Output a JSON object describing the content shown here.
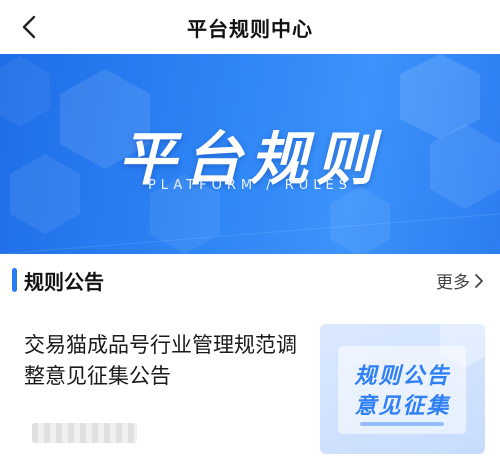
{
  "nav": {
    "title": "平台规则中心",
    "back_icon": "chevron-left-icon"
  },
  "banner": {
    "title": "平台规则",
    "subtitle": "PLATFORM / RULES"
  },
  "section": {
    "title": "规则公告",
    "more_label": "更多",
    "more_icon": "chevron-right-icon",
    "accent_color": "#2a7cf6"
  },
  "article": {
    "title": "交易猫成品号行业管理规范调整意见征集公告",
    "thumbnail": {
      "line1": "规则公告",
      "line2": "意见征集"
    }
  }
}
